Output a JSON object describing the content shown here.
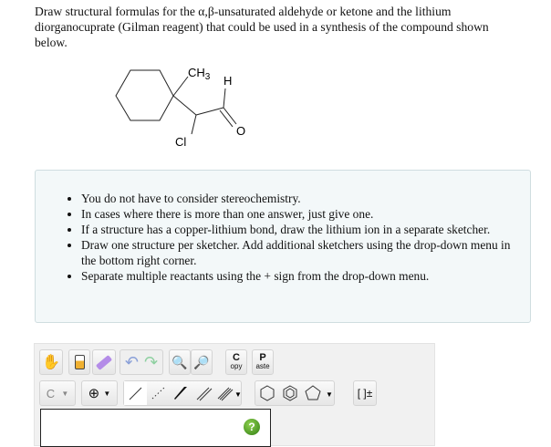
{
  "question": "Draw structural formulas for the α,β-unsaturated aldehyde or ketone and the lithium diorganocuprate (Gilman reagent) that could be used in a synthesis of the compound shown below.",
  "molecule": {
    "ch3": "CH3",
    "ch3_main": "CH",
    "ch3_sub": "3",
    "h": "H",
    "o": "O",
    "cl": "Cl"
  },
  "notes": [
    "You do not have to consider stereochemistry.",
    "In cases where there is more than one answer, just give one.",
    "If a structure has a copper-lithium bond, draw the lithium ion in a separate sketcher.",
    "Draw one structure per sketcher. Add additional sketchers using the drop-down menu in the bottom right corner.",
    "Separate multiple reactants using the + sign from the drop-down menu."
  ],
  "toolbar": {
    "copy_big": "C",
    "copy_small": "opy",
    "paste_big": "P",
    "paste_small": "aste",
    "atom": "C",
    "charge": "⊕",
    "bracket": "[ ]±",
    "help": "?"
  }
}
